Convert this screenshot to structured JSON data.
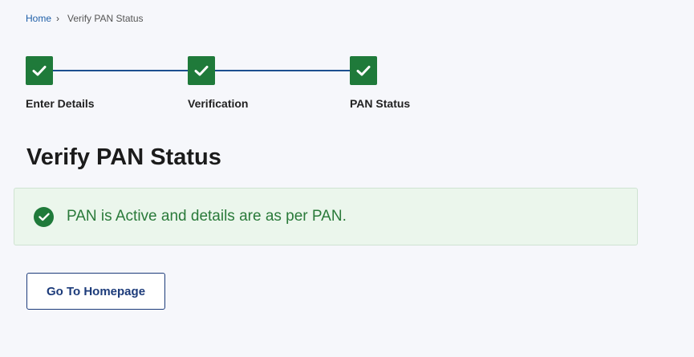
{
  "breadcrumb": {
    "home_label": "Home",
    "separator": "›",
    "current_label": "Verify PAN Status"
  },
  "stepper": {
    "steps": [
      {
        "label": "Enter Details",
        "status": "complete",
        "icon": "check-icon"
      },
      {
        "label": "Verification",
        "status": "complete",
        "icon": "check-icon"
      },
      {
        "label": "PAN Status",
        "status": "complete",
        "icon": "check-icon"
      }
    ],
    "complete_color": "#1f7a3a",
    "connector_color": "#1c4f8f"
  },
  "page_title": "Verify PAN Status",
  "alert": {
    "icon": "check-circle-icon",
    "message": "PAN is Active and details are as per PAN.",
    "background_color": "#ebf6ec",
    "text_color": "#2a7a3a"
  },
  "actions": {
    "home_button_label": "Go To Homepage",
    "button_color": "#1c3b7a"
  }
}
